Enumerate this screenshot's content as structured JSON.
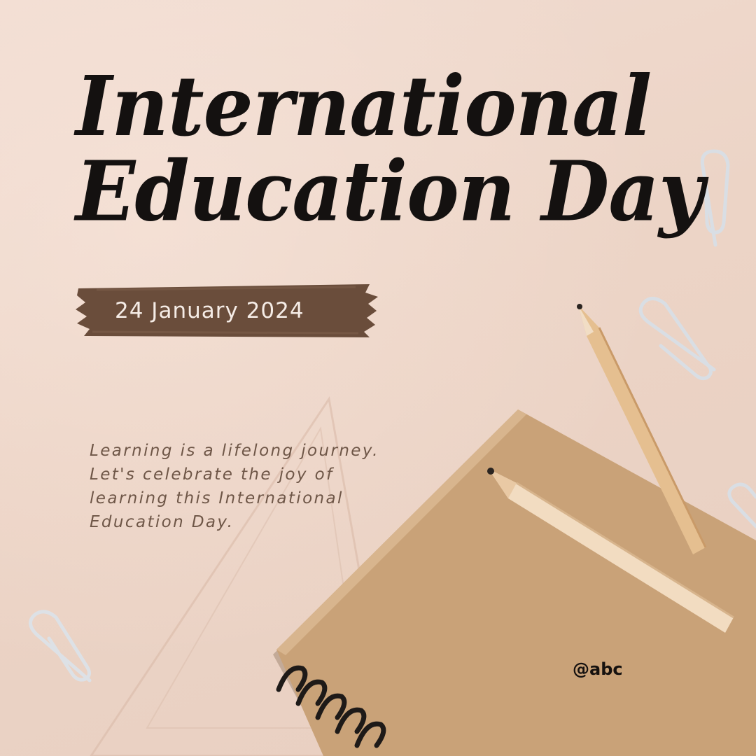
{
  "poster": {
    "title_lines": [
      "International",
      "Education Day"
    ],
    "date": "24 January 2024",
    "message_lines": [
      "Learning is a lifelong journey.",
      "Let's celebrate the joy of",
      "learning this International",
      "Education Day."
    ],
    "handle": "@abc"
  },
  "colors": {
    "background": "#eed7cb",
    "title": "#141110",
    "banner": "#6a4d3b",
    "date_text": "#f5ece6",
    "message": "#6e5647",
    "notebook": "#c9a278"
  },
  "icons": [
    "paperclip-icon",
    "pencil-icon",
    "notebook-icon",
    "triangle-ruler-icon"
  ]
}
